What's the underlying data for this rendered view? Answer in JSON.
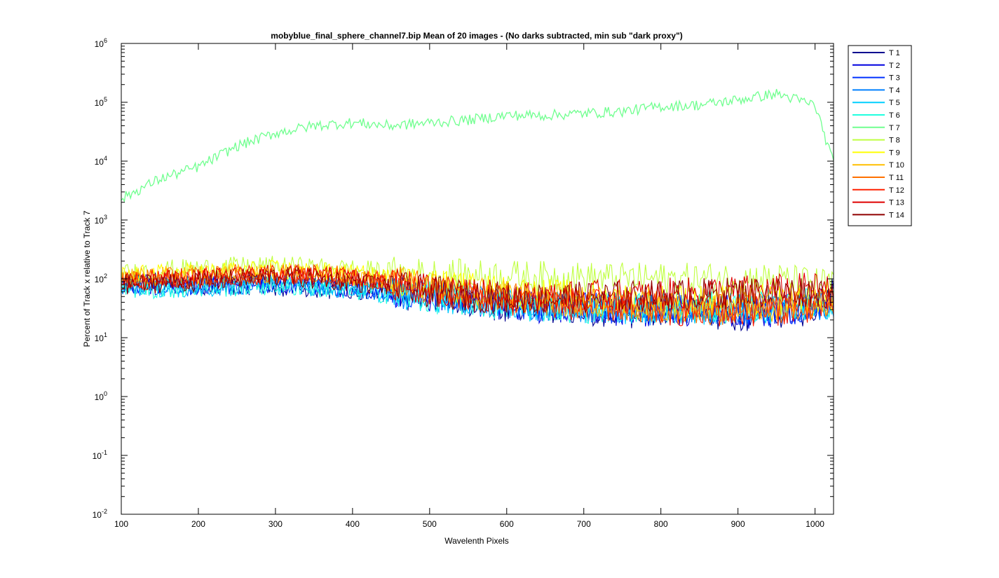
{
  "chart_data": {
    "type": "line",
    "title": "mobyblue_final_sphere_channel7.bip  Mean of 20 images - (No darks subtracted, min sub \"dark proxy\")",
    "xlabel": "Wavelenth Pixels",
    "ylabel": "Percent of Track x relative to Track 7",
    "xlim": [
      100,
      1024
    ],
    "ylim": [
      0.01,
      1000000
    ],
    "yscale": "log",
    "grid": false,
    "legend_position": "outside-right-top",
    "xticks": [
      100,
      200,
      300,
      400,
      500,
      600,
      700,
      800,
      900,
      1000
    ],
    "yticks": [
      {
        "base": "10",
        "exp": "-2",
        "value": 0.01
      },
      {
        "base": "10",
        "exp": "-1",
        "value": 0.1
      },
      {
        "base": "10",
        "exp": "0",
        "value": 1
      },
      {
        "base": "10",
        "exp": "1",
        "value": 10
      },
      {
        "base": "10",
        "exp": "2",
        "value": 100
      },
      {
        "base": "10",
        "exp": "3",
        "value": 1000
      },
      {
        "base": "10",
        "exp": "4",
        "value": 10000
      },
      {
        "base": "10",
        "exp": "5",
        "value": 100000
      },
      {
        "base": "10",
        "exp": "6",
        "value": 1000000
      }
    ],
    "x": [
      100,
      150,
      200,
      250,
      300,
      350,
      400,
      450,
      500,
      550,
      600,
      650,
      700,
      750,
      800,
      850,
      900,
      950,
      1000,
      1024
    ],
    "series": [
      {
        "name": "T 1",
        "color": "#00008f",
        "values": [
          90,
          85,
          80,
          78,
          75,
          70,
          65,
          55,
          50,
          40,
          35,
          32,
          30,
          28,
          25,
          24,
          24,
          26,
          30,
          100
        ]
      },
      {
        "name": "T 2",
        "color": "#0000df",
        "values": [
          85,
          80,
          78,
          80,
          82,
          75,
          68,
          58,
          52,
          42,
          36,
          33,
          31,
          29,
          27,
          26,
          26,
          28,
          32,
          50
        ]
      },
      {
        "name": "T 3",
        "color": "#0030ff",
        "values": [
          80,
          78,
          76,
          80,
          85,
          78,
          70,
          60,
          55,
          45,
          38,
          35,
          33,
          31,
          29,
          28,
          28,
          30,
          34,
          45
        ]
      },
      {
        "name": "T 4",
        "color": "#0080ff",
        "values": [
          78,
          76,
          75,
          78,
          82,
          76,
          68,
          58,
          52,
          44,
          38,
          35,
          33,
          32,
          30,
          30,
          30,
          32,
          36,
          42
        ]
      },
      {
        "name": "T 5",
        "color": "#00cfff",
        "values": [
          75,
          72,
          72,
          76,
          80,
          75,
          66,
          57,
          50,
          43,
          37,
          34,
          33,
          32,
          31,
          31,
          31,
          33,
          37,
          40
        ]
      },
      {
        "name": "T 6",
        "color": "#20ffdf",
        "values": [
          70,
          68,
          70,
          74,
          78,
          72,
          64,
          55,
          48,
          42,
          36,
          34,
          33,
          33,
          32,
          32,
          33,
          35,
          38,
          40
        ]
      },
      {
        "name": "T 7",
        "color": "#70ff8f",
        "values": [
          2300,
          5000,
          8000,
          18000,
          30000,
          40000,
          45000,
          40000,
          45000,
          50000,
          60000,
          60000,
          65000,
          70000,
          85000,
          90000,
          110000,
          140000,
          90000,
          9000
        ]
      },
      {
        "name": "T 8",
        "color": "#bfff40",
        "values": [
          120,
          140,
          150,
          160,
          165,
          155,
          145,
          130,
          120,
          115,
          112,
          108,
          105,
          102,
          100,
          100,
          102,
          100,
          85,
          80
        ]
      },
      {
        "name": "T 9",
        "color": "#ffff00",
        "values": [
          110,
          120,
          125,
          135,
          140,
          130,
          120,
          100,
          85,
          70,
          60,
          55,
          50,
          46,
          44,
          42,
          42,
          44,
          48,
          50
        ]
      },
      {
        "name": "T 10",
        "color": "#ffbf00",
        "values": [
          100,
          110,
          115,
          125,
          130,
          120,
          110,
          90,
          75,
          60,
          50,
          45,
          40,
          38,
          35,
          34,
          33,
          35,
          40,
          45
        ]
      },
      {
        "name": "T 11",
        "color": "#ff7000",
        "values": [
          95,
          105,
          110,
          120,
          125,
          120,
          110,
          90,
          72,
          58,
          48,
          42,
          38,
          35,
          32,
          30,
          30,
          32,
          36,
          40
        ]
      },
      {
        "name": "T 12",
        "color": "#ff2000",
        "values": [
          90,
          100,
          105,
          115,
          120,
          115,
          105,
          85,
          70,
          55,
          45,
          40,
          36,
          33,
          30,
          28,
          28,
          30,
          34,
          38
        ]
      },
      {
        "name": "T 13",
        "color": "#df0000",
        "values": [
          85,
          95,
          100,
          110,
          118,
          110,
          100,
          80,
          65,
          55,
          50,
          48,
          50,
          52,
          55,
          58,
          62,
          65,
          70,
          60
        ]
      },
      {
        "name": "T 14",
        "color": "#8f0000",
        "values": [
          80,
          85,
          90,
          100,
          110,
          100,
          90,
          75,
          60,
          52,
          48,
          46,
          48,
          50,
          52,
          55,
          58,
          60,
          62,
          55
        ]
      }
    ]
  }
}
